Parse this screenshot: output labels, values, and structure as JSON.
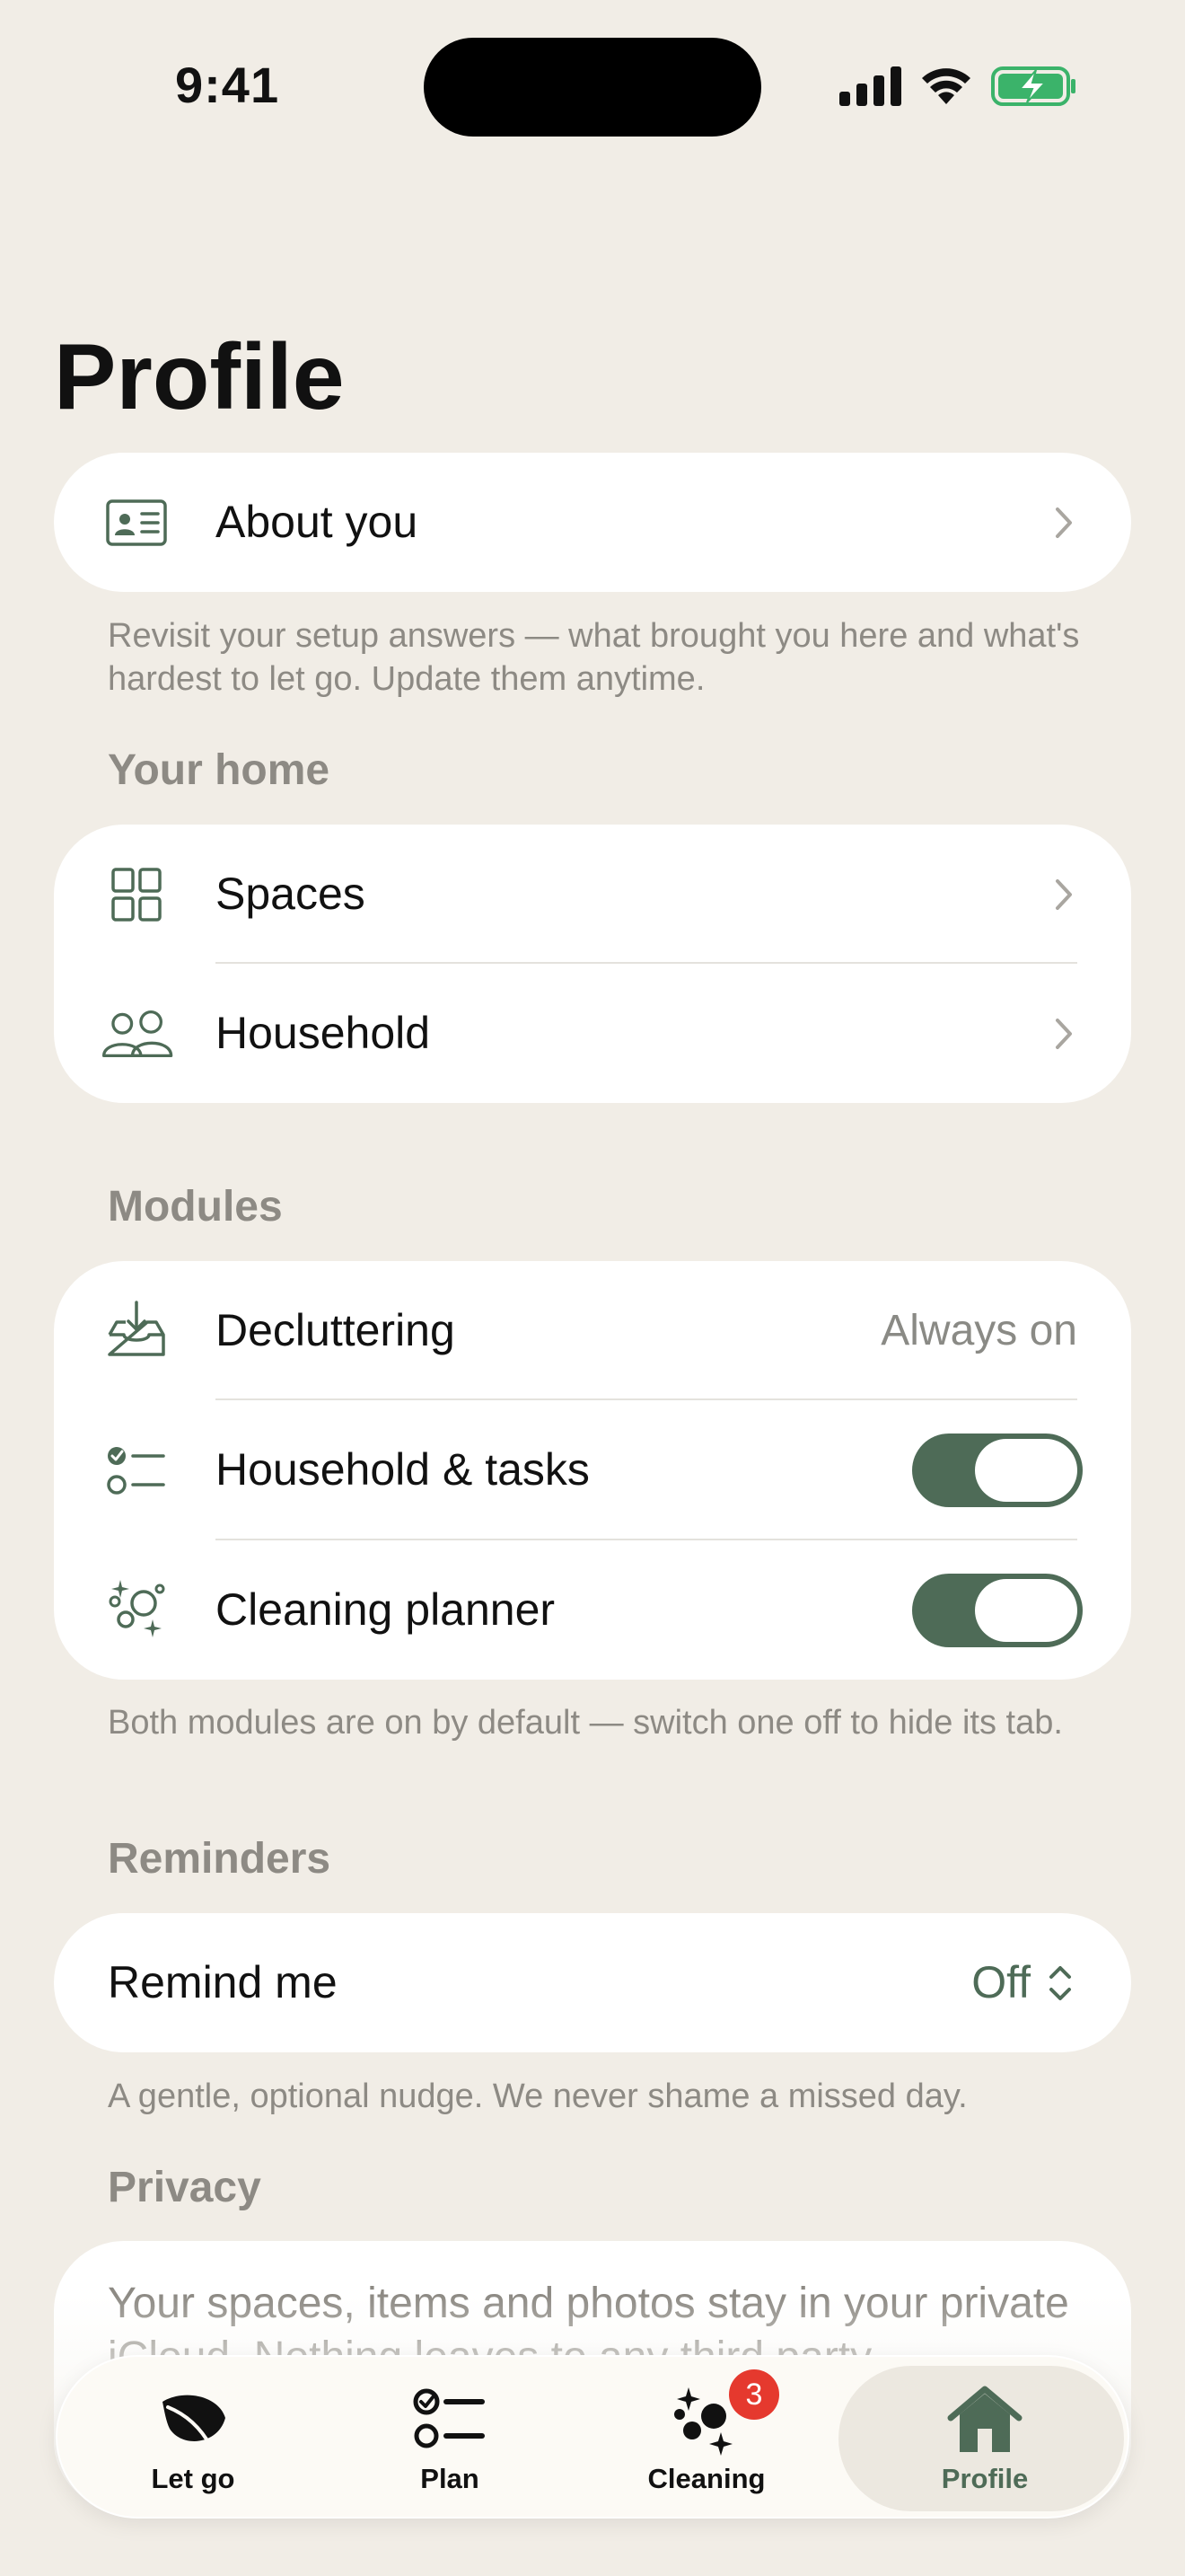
{
  "status_bar": {
    "time": "9:41"
  },
  "page": {
    "title": "Profile"
  },
  "about": {
    "label": "About you",
    "note": "Revisit your setup answers — what brought you here and what's hardest to let go. Update them anytime."
  },
  "home_section": {
    "title": "Your home",
    "items": [
      {
        "label": "Spaces",
        "icon": "grid-icon"
      },
      {
        "label": "Household",
        "icon": "people-icon"
      }
    ]
  },
  "modules_section": {
    "title": "Modules",
    "items": [
      {
        "label": "Decluttering",
        "value": "Always on",
        "icon": "inbox-download-icon"
      },
      {
        "label": "Household & tasks",
        "toggle_on": true,
        "icon": "checklist-icon"
      },
      {
        "label": "Cleaning planner",
        "toggle_on": true,
        "icon": "bubbles-sparkle-icon"
      }
    ],
    "note": "Both modules are on by default — switch one off to hide its tab."
  },
  "reminders_section": {
    "title": "Reminders",
    "label": "Remind me",
    "value": "Off",
    "note": "A gentle, optional nudge. We never shame a missed day."
  },
  "privacy_section": {
    "title": "Privacy",
    "text": "Your spaces, items and photos stay in your private iCloud. Nothing leaves to any third party."
  },
  "tabbar": {
    "tabs": [
      {
        "label": "Let go",
        "icon": "leaf-icon"
      },
      {
        "label": "Plan",
        "icon": "checklist-icon"
      },
      {
        "label": "Cleaning",
        "icon": "bubbles-sparkle-icon",
        "badge": "3"
      },
      {
        "label": "Profile",
        "icon": "house-icon",
        "active": true
      }
    ]
  },
  "colors": {
    "background": "#F1EDE6",
    "accent_green": "#4E6B57",
    "secondary_text": "#8D8A84",
    "badge_red": "#E5392E"
  }
}
